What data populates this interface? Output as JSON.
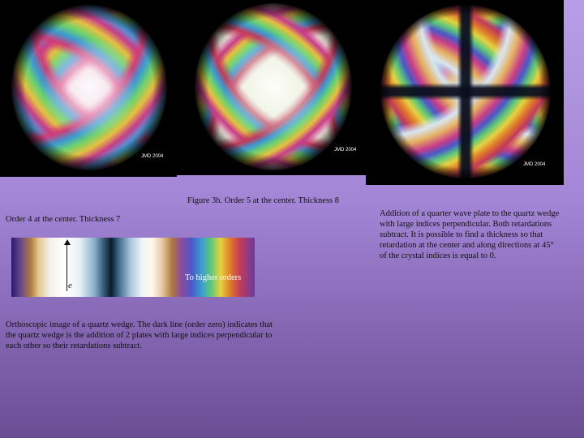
{
  "figures": [
    {
      "credit": "JMD 2004",
      "caption": "Order 4 at the center. Thickness 7"
    },
    {
      "credit": "JMD 2004",
      "caption": "Figure 3h.  Order 5 at the center.  Thickness 8"
    },
    {
      "credit": "JMD 2004",
      "caption": "Addition of a quarter wave plate to the quartz wedge with large indices perpendicular. Both retardations subtract. It is possible to find a thickness so that retardation at the center and along directions at 45° of the crystal indices is equal to 0."
    }
  ],
  "wedge": {
    "axis_label": "e",
    "arrow_label": "To higher orders",
    "caption": "Orthoscopic image of a quartz wedge. The dark line (order zero) indicates that the quartz wedge is the addition of 2 plates with large indices perpendicular to each other so their retardations subtract."
  },
  "colors": {
    "background_top": "#b89ee6",
    "background_bottom": "#6a4e93",
    "panel": "#000000"
  }
}
